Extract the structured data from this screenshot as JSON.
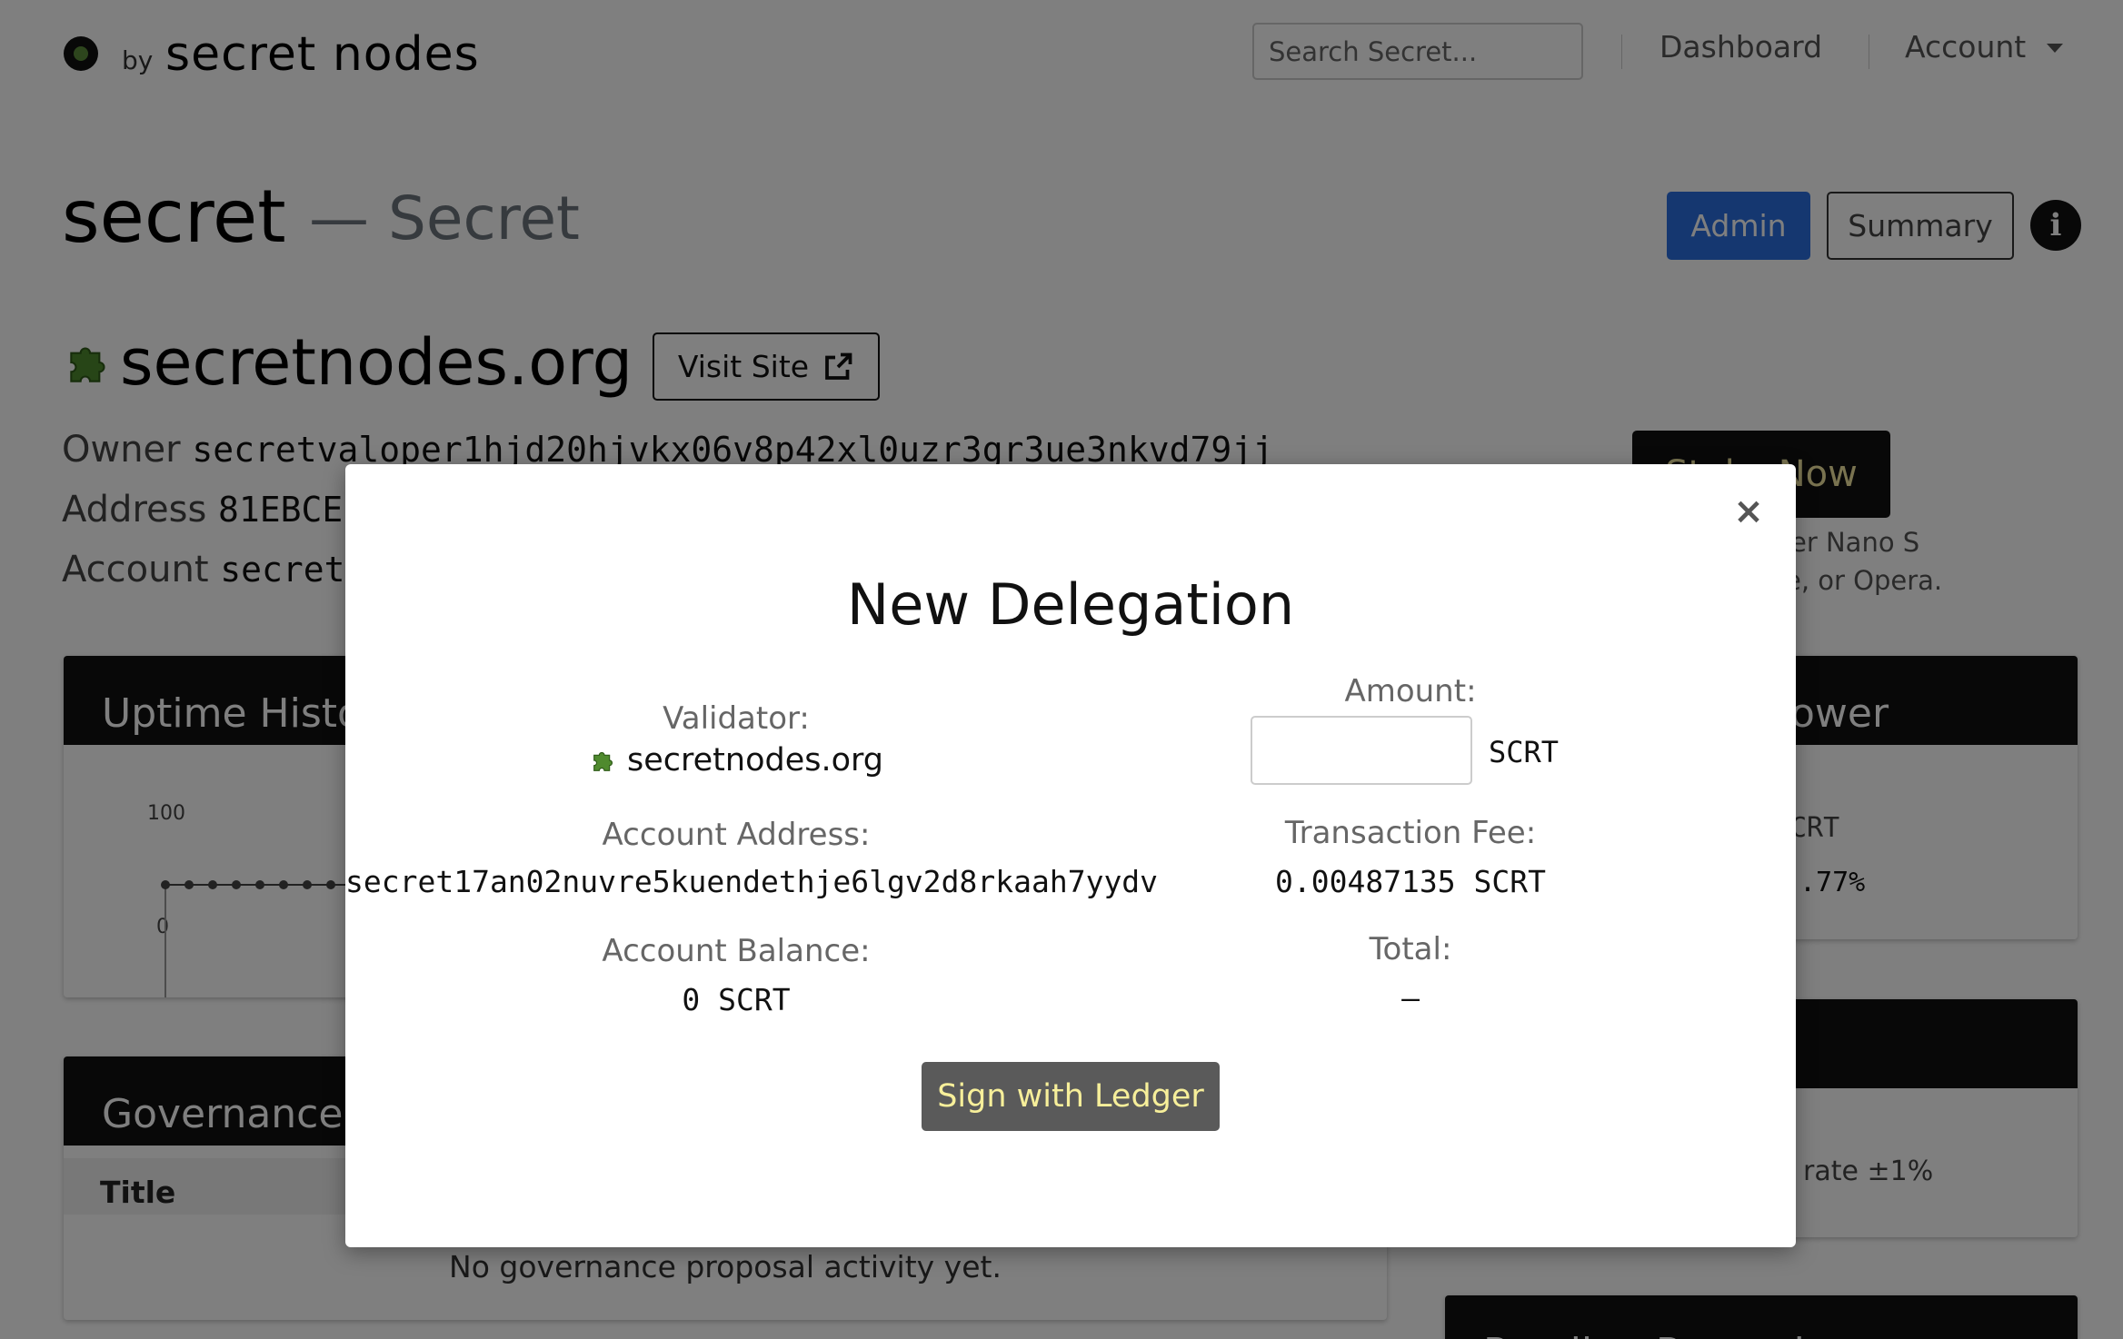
{
  "header": {
    "by": "by",
    "brand": "secret nodes",
    "search_placeholder": "Search Secret...",
    "nav": {
      "dashboard": "Dashboard",
      "account": "Account"
    }
  },
  "page": {
    "title": "secret",
    "subtitle": "— Secret",
    "admin": "Admin",
    "summary": "Summary",
    "site_name": "secretnodes.org",
    "visit_site": "Visit Site",
    "owner_label": "Owner",
    "owner_value": "secretvaloper1hjd20hjvkx06v8p42xl0uzr3gr3ue3nkvd79jj",
    "address_label": "Address",
    "address_value": "81EBCE",
    "account_label": "Account",
    "account_value": "secret",
    "stake_now": "Stake Now",
    "stake_note_1": "er Nano S",
    "stake_note_2": "e, or Opera."
  },
  "cards": {
    "uptime_title": "Uptime Histo",
    "uptime_y_top": "100",
    "uptime_y_bottom": "0",
    "governance_title": "Governance P",
    "governance_col": "Title",
    "governance_empty": "No governance proposal activity yet.",
    "power_title": "ower",
    "power_line_1": "CRT",
    "power_line_2": ".77%",
    "rate_text": "rate ±1%",
    "pending_title": "Pending Rewards"
  },
  "modal": {
    "title": "New Delegation",
    "validator_label": "Validator:",
    "validator_value": "secretnodes.org",
    "amount_label": "Amount:",
    "amount_value": "",
    "amount_unit": "SCRT",
    "account_address_label": "Account Address:",
    "account_address_value": "secret17an02nuvre5kuendethje6lgv2d8rkaah7yydv",
    "fee_label": "Transaction Fee:",
    "fee_value": "0.00487135 SCRT",
    "balance_label": "Account Balance:",
    "balance_value": "0 SCRT",
    "total_label": "Total:",
    "total_value": "—",
    "sign_button": "Sign with Ledger"
  },
  "colors": {
    "accent_blue": "#2a6fe0",
    "sign_text": "#f7ef9a",
    "puzzle_green": "#4f8a2e"
  },
  "icons": [
    "logo-icon",
    "info-icon",
    "external-link-icon",
    "puzzle-icon",
    "close-icon",
    "caret-down-icon"
  ]
}
